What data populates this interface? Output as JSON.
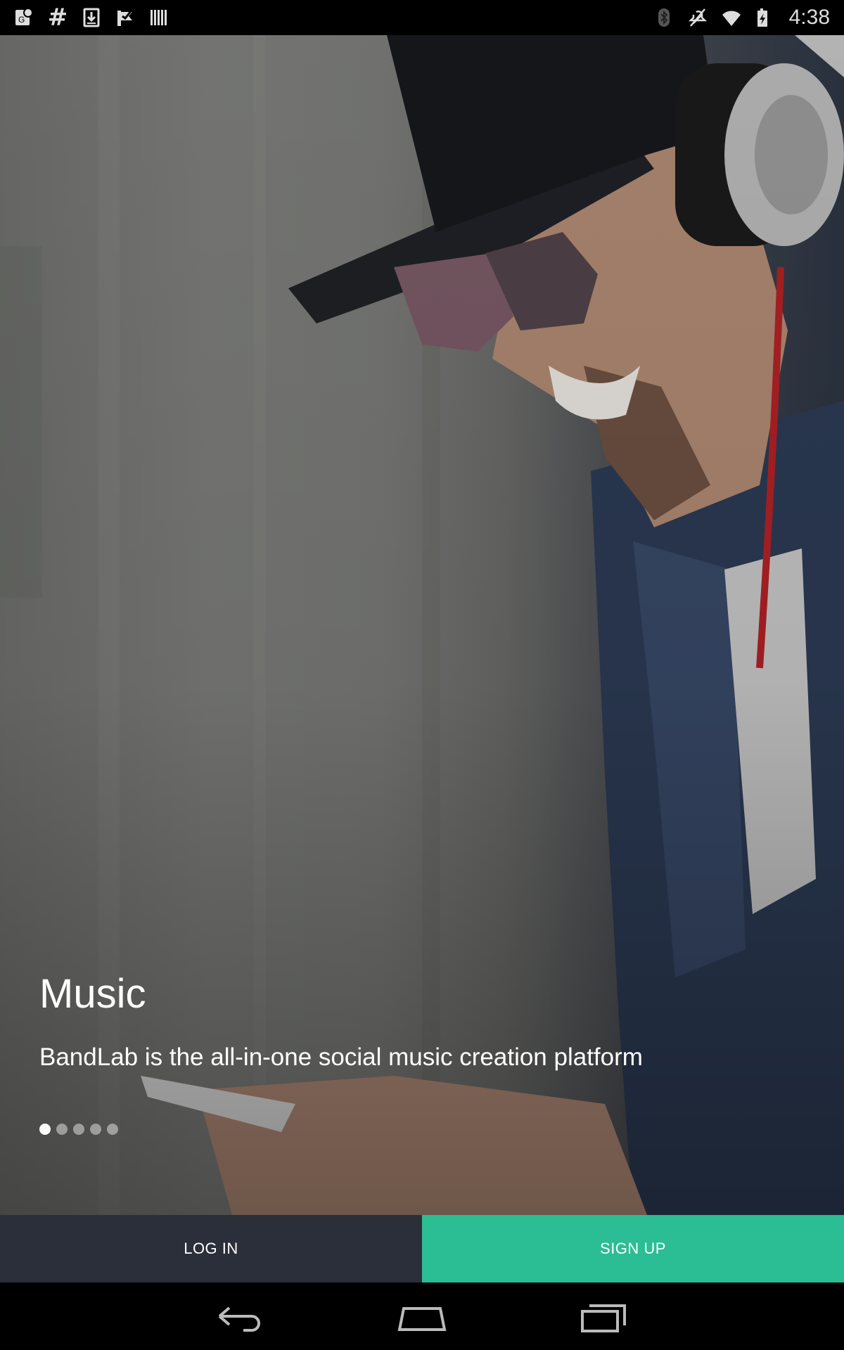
{
  "status_bar": {
    "left_icons": [
      "google-maps-icon",
      "hash-icon",
      "download-icon",
      "check-flag-icon",
      "barcode-icon"
    ],
    "hash_glyph": "#",
    "right_icons": [
      "bluetooth-icon",
      "mute-icon",
      "wifi-icon",
      "battery-charging-icon"
    ],
    "time": "4:38"
  },
  "hero": {
    "title": "Music",
    "subtitle": "BandLab is the all-in-one social music creation platform",
    "pager": {
      "count": 5,
      "active_index": 0
    }
  },
  "actions": {
    "login_label": "LOG IN",
    "signup_label": "SIGN UP"
  },
  "nav_bar": {
    "icons": [
      "back-icon",
      "home-icon",
      "recents-icon"
    ]
  },
  "colors": {
    "login_bg": "#2b2f3a",
    "signup_bg": "#2bbd93",
    "status_bar_bg": "#000000"
  }
}
